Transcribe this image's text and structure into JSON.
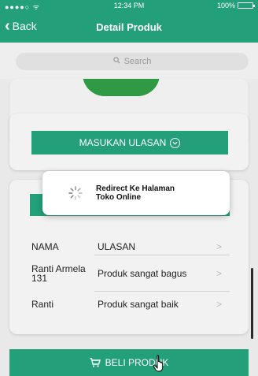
{
  "status_bar": {
    "carrier": "●●●●○ ᯤ",
    "time": "12:34 PM",
    "battery": "100%"
  },
  "nav": {
    "back_label": "Back",
    "title": "Detail Produk"
  },
  "search": {
    "placeholder": "Search"
  },
  "review_button": {
    "label": "MASUKAN ULASAN"
  },
  "toast": {
    "line1": "Redirect Ke Halaman",
    "line2": "Toko Online"
  },
  "reviews": {
    "header_name": "NAMA",
    "header_review": "ULASAN",
    "rows": [
      {
        "name": "Ranti Armela 131",
        "review": "Produk sangat bagus"
      },
      {
        "name": "Ranti",
        "review": "Produk sangat baik"
      }
    ]
  },
  "buy_button": {
    "label": "BELI PRODUK"
  },
  "colors": {
    "accent": "#23a07a",
    "product": "#2f9a43"
  },
  "icons": [
    "chevron-left-icon",
    "search-icon",
    "chevron-down-icon",
    "chevron-right-icon",
    "spinner-icon",
    "cart-icon",
    "hand-cursor-icon",
    "battery-icon"
  ]
}
